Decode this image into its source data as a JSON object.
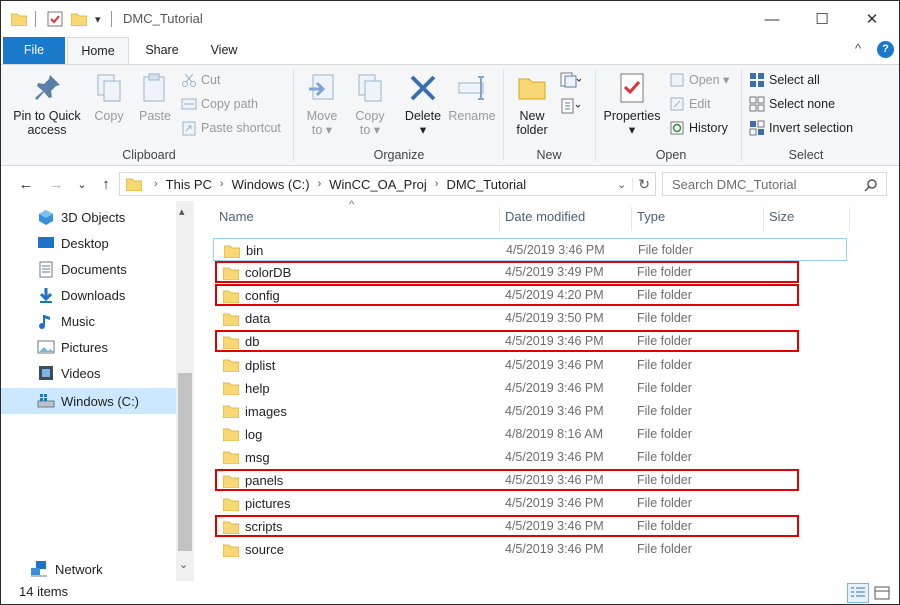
{
  "window": {
    "title": "DMC_Tutorial",
    "controls": {
      "minimize": "—",
      "maximize": "☐",
      "close": "✕"
    }
  },
  "quick_access": {
    "dropdown": "▾"
  },
  "tabs": [
    {
      "label": "File"
    },
    {
      "label": "Home"
    },
    {
      "label": "Share"
    },
    {
      "label": "View"
    }
  ],
  "ribbon_controls": {
    "collapse": "^",
    "help": "?"
  },
  "ribbon": {
    "clipboard": {
      "label": "Clipboard",
      "pin_label_1": "Pin to Quick",
      "pin_label_2": "access",
      "copy": "Copy",
      "paste": "Paste",
      "cut": "Cut",
      "copy_path": "Copy path",
      "paste_shortcut": "Paste shortcut"
    },
    "organize": {
      "label": "Organize",
      "move_to_1": "Move",
      "move_to_2": "to ▾",
      "copy_to_1": "Copy",
      "copy_to_2": "to ▾",
      "delete_1": "Delete",
      "delete_2": "▾",
      "rename": "Rename"
    },
    "new": {
      "label": "New",
      "new_folder_1": "New",
      "new_folder_2": "folder"
    },
    "open": {
      "label": "Open",
      "properties_1": "Properties",
      "properties_2": "▾",
      "open": "Open ▾",
      "edit": "Edit",
      "history": "History"
    },
    "select": {
      "label": "Select",
      "select_all": "Select all",
      "select_none": "Select none",
      "invert_selection": "Invert selection"
    }
  },
  "nav": {
    "back": "←",
    "forward": "→",
    "recent": "⌄",
    "up": "↑",
    "refresh": "↻",
    "address_dropdown": "⌄",
    "breadcrumbs": [
      "This PC",
      "Windows (C:)",
      "WinCC_OA_Proj",
      "DMC_Tutorial"
    ],
    "crumb_sep": "›",
    "search_placeholder": "Search DMC_Tutorial"
  },
  "sidebar": {
    "items": [
      {
        "label": "3D Objects"
      },
      {
        "label": "Desktop"
      },
      {
        "label": "Documents"
      },
      {
        "label": "Downloads"
      },
      {
        "label": "Music"
      },
      {
        "label": "Pictures"
      },
      {
        "label": "Videos"
      },
      {
        "label": "Windows (C:)",
        "selected": true
      },
      {
        "label": "Network"
      }
    ],
    "scroll_up": "▴",
    "scroll_down": "⌄"
  },
  "file_list": {
    "sort_indicator": "^",
    "columns": [
      "Name",
      "Date modified",
      "Type",
      "Size"
    ],
    "rows": [
      {
        "name": "bin",
        "date": "4/5/2019 3:46 PM",
        "type": "File folder",
        "highlighted": false
      },
      {
        "name": "colorDB",
        "date": "4/5/2019 3:49 PM",
        "type": "File folder",
        "highlighted": true
      },
      {
        "name": "config",
        "date": "4/5/2019 4:20 PM",
        "type": "File folder",
        "highlighted": true
      },
      {
        "name": "data",
        "date": "4/5/2019 3:50 PM",
        "type": "File folder",
        "highlighted": false
      },
      {
        "name": "db",
        "date": "4/5/2019 3:46 PM",
        "type": "File folder",
        "highlighted": true
      },
      {
        "name": "dplist",
        "date": "4/5/2019 3:46 PM",
        "type": "File folder",
        "highlighted": false
      },
      {
        "name": "help",
        "date": "4/5/2019 3:46 PM",
        "type": "File folder",
        "highlighted": false
      },
      {
        "name": "images",
        "date": "4/5/2019 3:46 PM",
        "type": "File folder",
        "highlighted": false
      },
      {
        "name": "log",
        "date": "4/8/2019 8:16 AM",
        "type": "File folder",
        "highlighted": false
      },
      {
        "name": "msg",
        "date": "4/5/2019 3:46 PM",
        "type": "File folder",
        "highlighted": false
      },
      {
        "name": "panels",
        "date": "4/5/2019 3:46 PM",
        "type": "File folder",
        "highlighted": true
      },
      {
        "name": "pictures",
        "date": "4/5/2019 3:46 PM",
        "type": "File folder",
        "highlighted": false
      },
      {
        "name": "scripts",
        "date": "4/5/2019 3:46 PM",
        "type": "File folder",
        "highlighted": true
      },
      {
        "name": "source",
        "date": "4/5/2019 3:46 PM",
        "type": "File folder",
        "highlighted": false
      }
    ]
  },
  "status": {
    "item_count": "14 items"
  },
  "colors": {
    "file_tab": "#1979ca",
    "folder": "#f8d775",
    "highlight_box": "#e00000",
    "selection": "#cce8ff",
    "header_text": "#4c607a"
  },
  "icons": {
    "folder": "folder-icon",
    "pin": "pin-icon",
    "delete": "delete-x-icon",
    "search": "search-icon"
  }
}
